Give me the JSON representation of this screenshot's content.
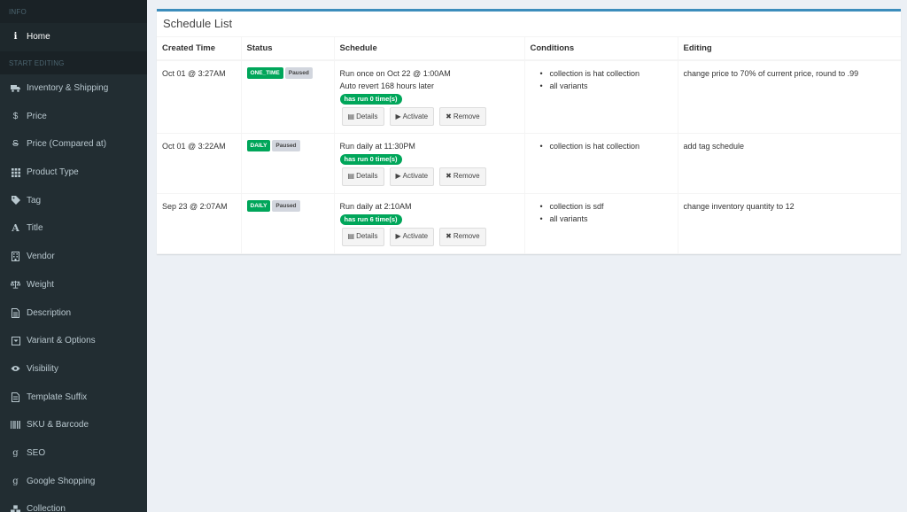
{
  "sidebar": {
    "info_header": "INFO",
    "home": {
      "label": "Home",
      "icon": "info-icon"
    },
    "editing_header": "START EDITING",
    "items": [
      {
        "label": "Inventory & Shipping",
        "icon": "truck-icon"
      },
      {
        "label": "Price",
        "icon": "dollar-icon"
      },
      {
        "label": "Price (Compared at)",
        "icon": "strike-dollar-icon"
      },
      {
        "label": "Product Type",
        "icon": "grid-icon"
      },
      {
        "label": "Tag",
        "icon": "tag-icon"
      },
      {
        "label": "Title",
        "icon": "font-icon"
      },
      {
        "label": "Vendor",
        "icon": "building-icon"
      },
      {
        "label": "Weight",
        "icon": "scale-icon"
      },
      {
        "label": "Description",
        "icon": "document-icon"
      },
      {
        "label": "Variant & Options",
        "icon": "archive-icon"
      },
      {
        "label": "Visibility",
        "icon": "eye-icon"
      },
      {
        "label": "Template Suffix",
        "icon": "file-icon"
      },
      {
        "label": "SKU & Barcode",
        "icon": "barcode-icon"
      },
      {
        "label": "SEO",
        "icon": "google-icon"
      },
      {
        "label": "Google Shopping",
        "icon": "google-icon"
      },
      {
        "label": "Collection",
        "icon": "cubes-icon"
      }
    ]
  },
  "panel": {
    "title": "Schedule List",
    "columns": [
      "Created Time",
      "Status",
      "Schedule",
      "Conditions",
      "Editing"
    ],
    "buttons": {
      "details": "Details",
      "activate": "Activate",
      "remove": "Remove"
    },
    "rows": [
      {
        "created": "Oct 01 @ 3:27AM",
        "type": "ONE_TIME",
        "state": "Paused",
        "schedule_line1": "Run once on Oct 22 @ 1:00AM",
        "schedule_line2": "Auto revert 168 hours later",
        "run_count": "has run 0 time(s)",
        "conditions": [
          "collection is hat collection",
          "all variants"
        ],
        "editing": "change price to 70% of current price, round to .99"
      },
      {
        "created": "Oct 01 @ 3:22AM",
        "type": "DAILY",
        "state": "Paused",
        "schedule_line1": "Run daily at 11:30PM",
        "schedule_line2": "",
        "run_count": "has run 0 time(s)",
        "conditions": [
          "collection is hat collection"
        ],
        "editing": "add tag schedule"
      },
      {
        "created": "Sep 23 @ 2:07AM",
        "type": "DAILY",
        "state": "Paused",
        "schedule_line1": "Run daily at 2:10AM",
        "schedule_line2": "",
        "run_count": "has run 6 time(s)",
        "conditions": [
          "collection is sdf",
          "all variants"
        ],
        "editing": "change inventory quantity to 12"
      }
    ]
  },
  "colors": {
    "accent": "#3c8dbc",
    "success": "#00a65a",
    "sidebar_bg": "#222d32"
  }
}
